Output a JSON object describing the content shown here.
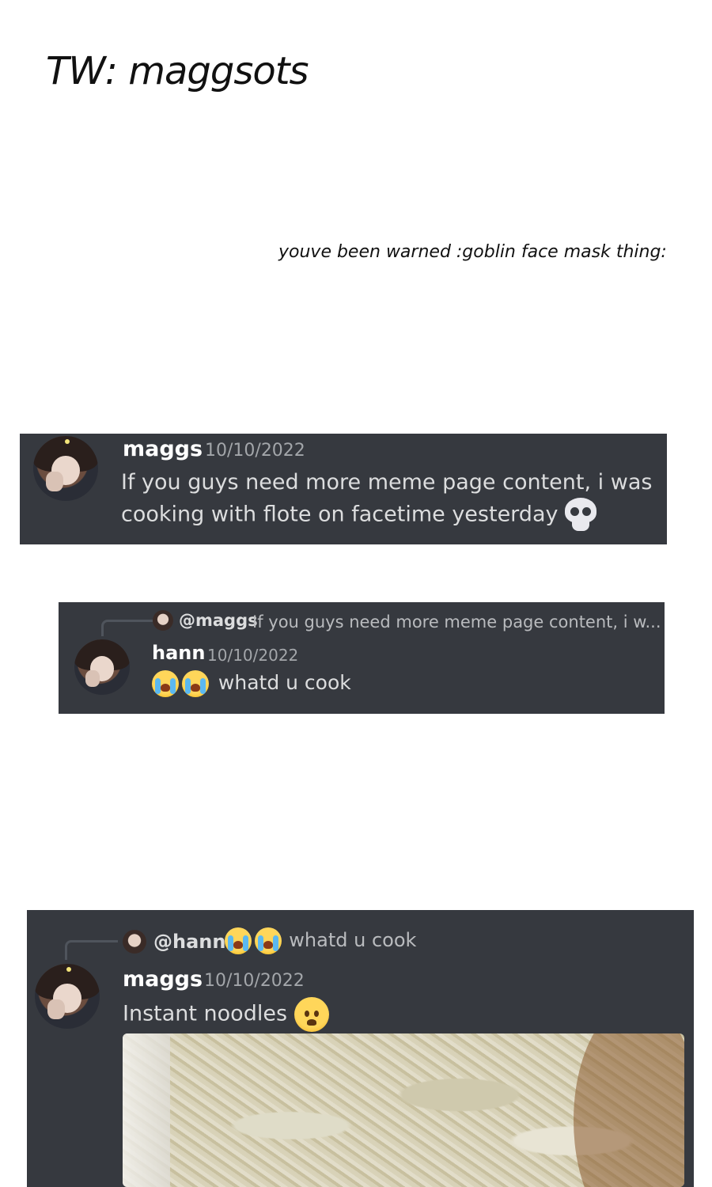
{
  "header": {
    "title": "TW: maggsots",
    "subtitle": "youve been warned :goblin face mask thing:"
  },
  "messages": [
    {
      "author": "maggs",
      "timestamp": "10/10/2022",
      "text_line1": "If you guys need more meme page content, i was",
      "text_line2": "cooking with flote on facetime yesterday",
      "emoji": "skull-icon"
    },
    {
      "reply_to_author": "@maggs",
      "reply_to_text": "If you guys need more meme page content, i w...",
      "author": "hann",
      "timestamp": "10/10/2022",
      "text": "whatd u cook",
      "emoji": "loudly-crying-icon"
    },
    {
      "reply_to_author": "@hann",
      "reply_to_text": "whatd u cook",
      "author": "maggs",
      "timestamp": "10/10/2022",
      "text": "Instant noodles",
      "emoji": "worried-face-icon"
    }
  ],
  "colors": {
    "message_bg": "#36393f",
    "text": "#dcddde",
    "timestamp": "#a3a6aa"
  }
}
